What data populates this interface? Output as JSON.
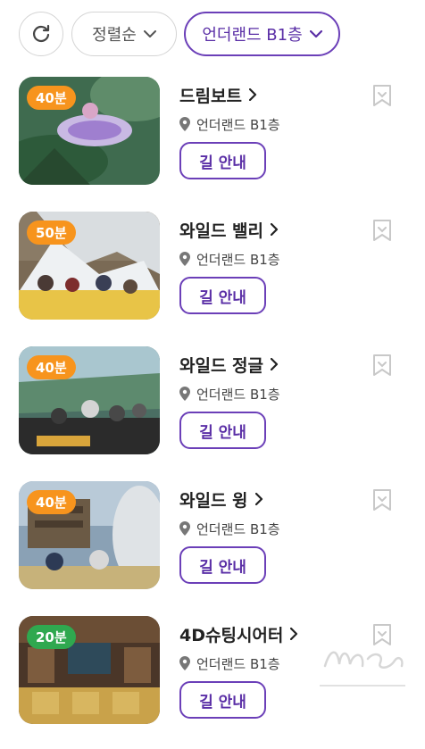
{
  "toolbar": {
    "sort_label": "정렬순",
    "floor_label": "언더랜드 B1층"
  },
  "attractions": [
    {
      "title": "드림보트",
      "location": "언더랜드 B1층",
      "wait": "40분",
      "badge_color": "#f7941d",
      "guide_label": "길 안내"
    },
    {
      "title": "와일드 밸리",
      "location": "언더랜드 B1층",
      "wait": "50분",
      "badge_color": "#f7941d",
      "guide_label": "길 안내"
    },
    {
      "title": "와일드 정글",
      "location": "언더랜드 B1층",
      "wait": "40분",
      "badge_color": "#f7941d",
      "guide_label": "길 안내"
    },
    {
      "title": "와일드 윙",
      "location": "언더랜드 B1층",
      "wait": "40분",
      "badge_color": "#f7941d",
      "guide_label": "길 안내"
    },
    {
      "title": "4D슈팅시어터",
      "location": "언더랜드 B1층",
      "wait": "20분",
      "badge_color": "#2fa84f",
      "guide_label": "길 안내"
    }
  ],
  "colors": {
    "accent": "#6b3fb8",
    "wait_orange": "#f7941d",
    "wait_green": "#2fa84f"
  },
  "icons": [
    "refresh-icon",
    "chevron-down-icon",
    "chevron-right-icon",
    "location-pin-icon",
    "bookmark-icon"
  ]
}
